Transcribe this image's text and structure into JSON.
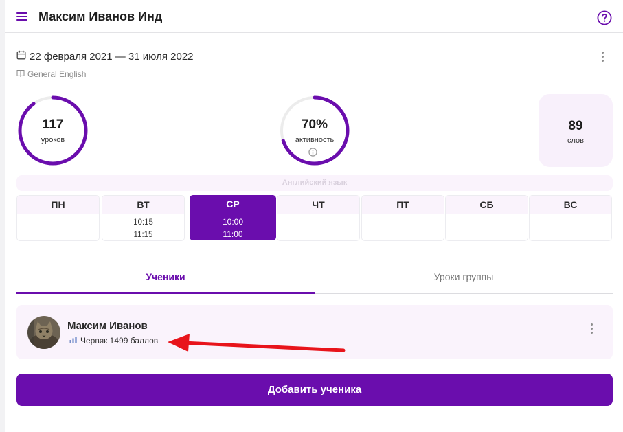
{
  "header": {
    "title": "Максим Иванов Инд",
    "menu_icon": "hamburger-menu-icon",
    "help_icon": "question-circle-icon"
  },
  "group": {
    "date_range": "22 февраля 2021 — 31 июля 2022",
    "course": "General English"
  },
  "stats": {
    "lessons": {
      "value": "117",
      "label": "уроков",
      "progress": 0.9
    },
    "activity": {
      "value": "70%",
      "label": "активность",
      "progress": 0.7
    },
    "words": {
      "value": "89",
      "label": "слов"
    }
  },
  "schedule": {
    "language": "Английский язык",
    "days": [
      {
        "name": "ПН",
        "times": []
      },
      {
        "name": "ВТ",
        "times": [
          "10:15",
          "11:15"
        ]
      },
      {
        "name": "СР",
        "times": [
          "10:00",
          "11:00"
        ],
        "active": true
      },
      {
        "name": "ЧТ",
        "times": []
      },
      {
        "name": "ПТ",
        "times": []
      },
      {
        "name": "СБ",
        "times": []
      },
      {
        "name": "ВС",
        "times": []
      }
    ]
  },
  "tabs": {
    "students": "Ученики",
    "lessons": "Уроки группы",
    "active": "students"
  },
  "student": {
    "name": "Максим Иванов",
    "level": "Червяк 1499 баллов"
  },
  "actions": {
    "add_student": "Добавить ученика"
  },
  "colors": {
    "accent": "#6a0dad",
    "card_bg": "#faf3fc",
    "ring_track": "#ececec",
    "annotation": "#e8141b"
  }
}
